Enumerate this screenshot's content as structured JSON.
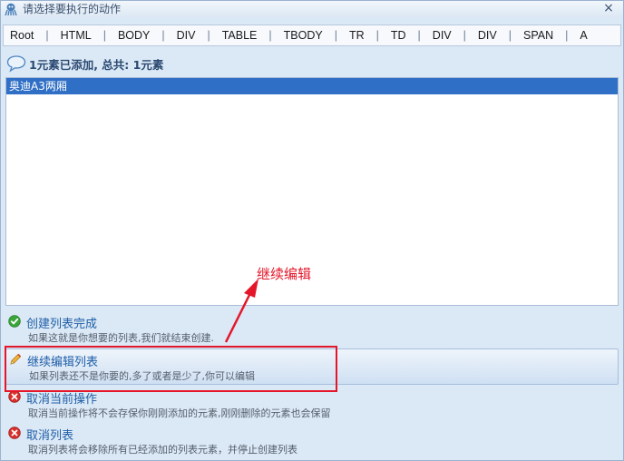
{
  "window": {
    "title": "请选择要执行的动作",
    "close_glyph": "×"
  },
  "breadcrumb": {
    "items": [
      "Root",
      "HTML",
      "BODY",
      "DIV",
      "TABLE",
      "TBODY",
      "TR",
      "TD",
      "DIV",
      "DIV",
      "SPAN",
      "A"
    ],
    "separator": "|"
  },
  "summary": {
    "text": "1元素已添加, 总共: 1元素",
    "icon": "speech-bubble-icon"
  },
  "list": {
    "items": [
      "奥迪A3两厢"
    ],
    "selected_index": 0
  },
  "options": [
    {
      "title": "创建列表完成",
      "desc": "如果这就是你想要的列表,我们就结束创建.",
      "icon": "check-circle-icon",
      "icon_color": "#3aa63a"
    },
    {
      "title": "继续编辑列表",
      "desc": "如果列表还不是你要的,多了或者是少了,你可以编辑",
      "icon": "pencil-icon",
      "icon_color": "#e0a020"
    },
    {
      "title": "取消当前操作",
      "desc": "取消当前操作将不会存保你刚刚添加的元素,刚刚删除的元素也会保留",
      "icon": "x-circle-icon",
      "icon_color": "#d9302c"
    },
    {
      "title": "取消列表",
      "desc": "取消列表将会移除所有已经添加的列表元素，并停止创建列表",
      "icon": "x-circle-icon",
      "icon_color": "#d9302c"
    }
  ],
  "annotation": {
    "text": "继续编辑",
    "color": "#e4162a"
  },
  "colors": {
    "selection": "#2f6fc5",
    "link": "#1f5fa8",
    "window_bg": "#dbe8f5"
  }
}
